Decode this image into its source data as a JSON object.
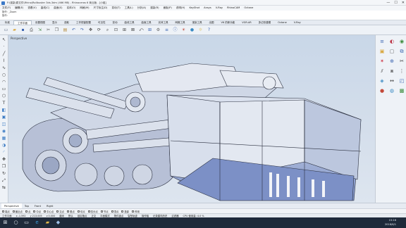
{
  "window": {
    "title": "F:\\渲染\\原文件\\Rhino\\Rollbuster 3ds.3dm (466 MB) - Rhinoceros 6 商业版 - [小组]",
    "controls": [
      "—",
      "☐",
      "✕"
    ]
  },
  "menu": [
    "文件(F)",
    "编辑(E)",
    "查看(V)",
    "曲线(C)",
    "曲面(S)",
    "实体(O)",
    "网格(M)",
    "尺寸标注(D)",
    "变动(T)",
    "工具(L)",
    "分析(A)",
    "渲染(R)",
    "面板(P)",
    "说明(H)",
    "KeyShot",
    "Ansys",
    "V-Ray",
    "RhinoCAM",
    "Octane"
  ],
  "command_history": [
    "指令: _Zoom",
    "指令:"
  ],
  "tabs": [
    "标准",
    "工作平面",
    "设置视图",
    "显示",
    "选取",
    "工作视窗配置",
    "可见性",
    "变动",
    "曲线工具",
    "曲面工具",
    "实体工具",
    "网格工具",
    "渲染工具",
    "出图",
    "V6 的新功能",
    "VGR-AR",
    "多边形建模",
    "Octane",
    "V-Ray",
    "工作平面",
    "设定视图",
    "显示",
    "选取",
    "工作视窗",
    "可见性",
    "变动",
    "曲线工具",
    "曲面工具",
    "实体工具",
    "网格工具",
    "渲染工具",
    "出图",
    "RhinoCAM",
    "T-Splines",
    "PeTools",
    "WeaverBird"
  ],
  "active_tab_index": 1,
  "toolbar_icons": [
    "new-file-icon",
    "open-file-icon",
    "save-icon",
    "print-icon",
    "import-icon",
    "cut-icon",
    "copy-icon",
    "paste-icon",
    "undo-icon",
    "redo-icon",
    "pan-icon",
    "rotate-view-icon",
    "zoom-icon",
    "zoom-window-icon",
    "zoom-extents-icon",
    "zoom-selected-icon",
    "undo-view-icon",
    "four-views-icon",
    "options-icon",
    "layers-icon",
    "properties-icon",
    "render-icon",
    "material-icon",
    "light-icon",
    "help-icon"
  ],
  "viewport": {
    "label": "Perspective"
  },
  "view_tabs": [
    "Perspective",
    "Top",
    "Front",
    "Right"
  ],
  "active_view_tab": 0,
  "osnap": [
    "端点",
    "最近点",
    "点",
    "中点",
    "中心点",
    "交点",
    "垂点",
    "切点",
    "四分点",
    "节点",
    "顶点",
    "投影",
    "停用"
  ],
  "status": {
    "cplane": "工作平面",
    "x": "x -1.592",
    "y": "y 213.005",
    "z": "z 0.000",
    "units": "厘米",
    "layer": "默认",
    "grid_snap": "锁定格点",
    "ortho": "正交",
    "planar": "平面模式",
    "osnap_label": "物件锁点",
    "smarttrack": "智慧轨迹",
    "gumball": "操作轴",
    "record_history": "记录建构历史",
    "filter": "过滤器",
    "cpu": "CPU 使用量: 4.0 %"
  },
  "taskbar": {
    "time": "15:16",
    "date": "2018/6/1"
  },
  "colors": {
    "model_face": "#dde3ee",
    "model_shadow": "#7a8fc2",
    "model_edge": "#2a2f3f",
    "viewport_bg_top": "#c9d7e8"
  }
}
